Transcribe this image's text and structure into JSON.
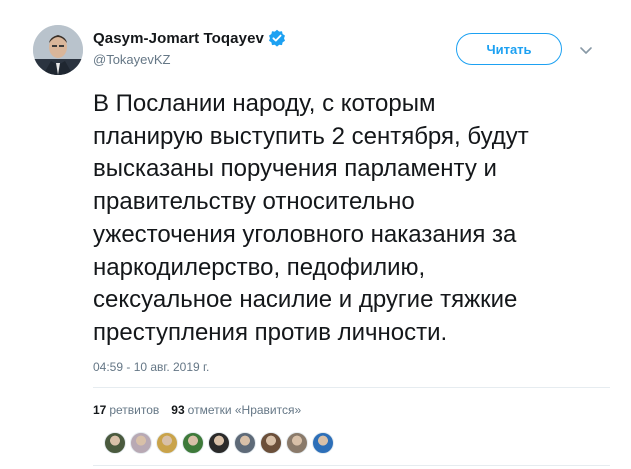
{
  "author": {
    "display_name": "Qasym-Jomart Toqayev",
    "handle": "@TokayevKZ",
    "verified_icon": "verified-badge-icon"
  },
  "actions": {
    "follow_label": "Читать",
    "more_icon": "chevron-down-icon"
  },
  "tweet": {
    "text_lines": [
      "В Послании народу, с  которым",
      "планирую выступить 2 сентября, будут",
      "высказаны поручения парламенту и",
      "правительству относительно",
      "ужесточения уголовного наказания за",
      "наркодилерство, педофилию,",
      "сексуальное насилие и другие тяжкие",
      "преступления против личности."
    ],
    "timestamp": "04:59 - 10 авг. 2019 г."
  },
  "stats": {
    "retweets_count": "17",
    "retweets_label": "ретвитов",
    "likes_count": "93",
    "likes_label": "отметки «Нравится»"
  },
  "likers": [
    {
      "color": "#4a5a3e"
    },
    {
      "color": "#b8a9b4"
    },
    {
      "color": "#c9a34a"
    },
    {
      "color": "#3e7a3a"
    },
    {
      "color": "#2a2a2a"
    },
    {
      "color": "#5e6a78"
    },
    {
      "color": "#6b4f3a"
    },
    {
      "color": "#8a7a6a"
    },
    {
      "color": "#2d6fb8"
    }
  ],
  "colors": {
    "accent": "#1da1f2",
    "secondary_text": "#657786",
    "primary_text": "#14171a"
  }
}
